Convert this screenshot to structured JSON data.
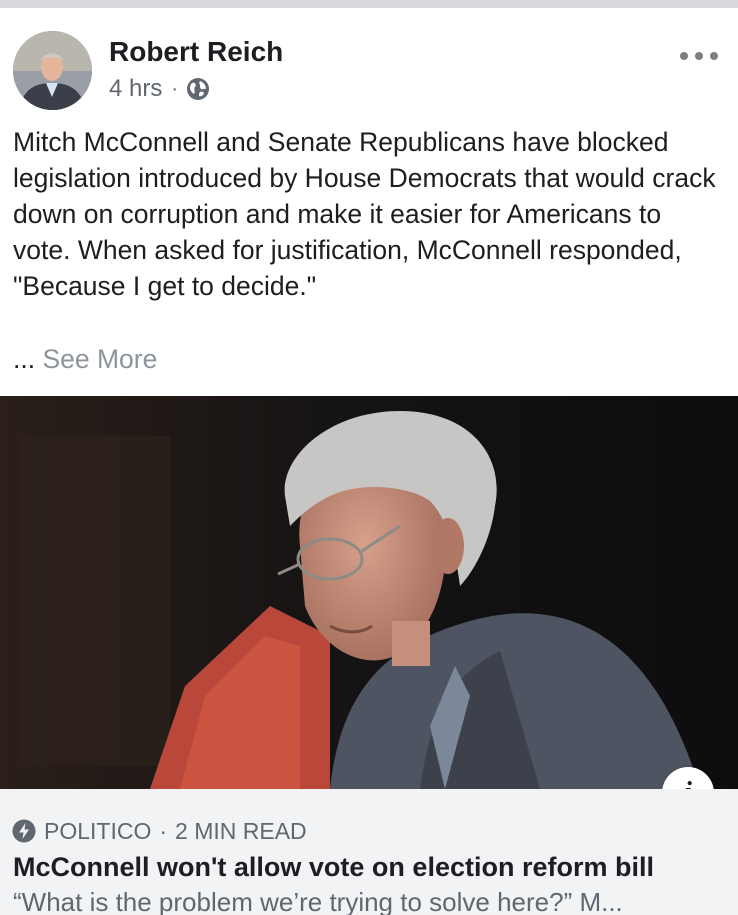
{
  "post": {
    "author": "Robert Reich",
    "time": "4 hrs",
    "separator": "·",
    "privacy_icon": "globe-icon",
    "more_icon": "more-options-icon",
    "text": "Mitch McConnell and Senate Republicans have blocked legislation introduced by House Democrats that would crack down on corruption and make it easier for Americans to vote. When asked for justification, McConnell responded, \"Because I get to decide.\"",
    "ellipsis": "...",
    "see_more": "See More"
  },
  "link": {
    "image_icon": "info-icon",
    "info_label": "i",
    "source_icon": "instant-article-bolt-icon",
    "source": "POLITICO",
    "separator": "·",
    "read_time": "2 MIN READ",
    "title": "McConnell won't allow vote on election reform bill",
    "description": "“What is the problem we’re trying to solve here?” M..."
  },
  "colors": {
    "text": "#1c1e21",
    "meta": "#616770",
    "see_more": "#8d949e",
    "card_background": "#f2f3f5"
  }
}
